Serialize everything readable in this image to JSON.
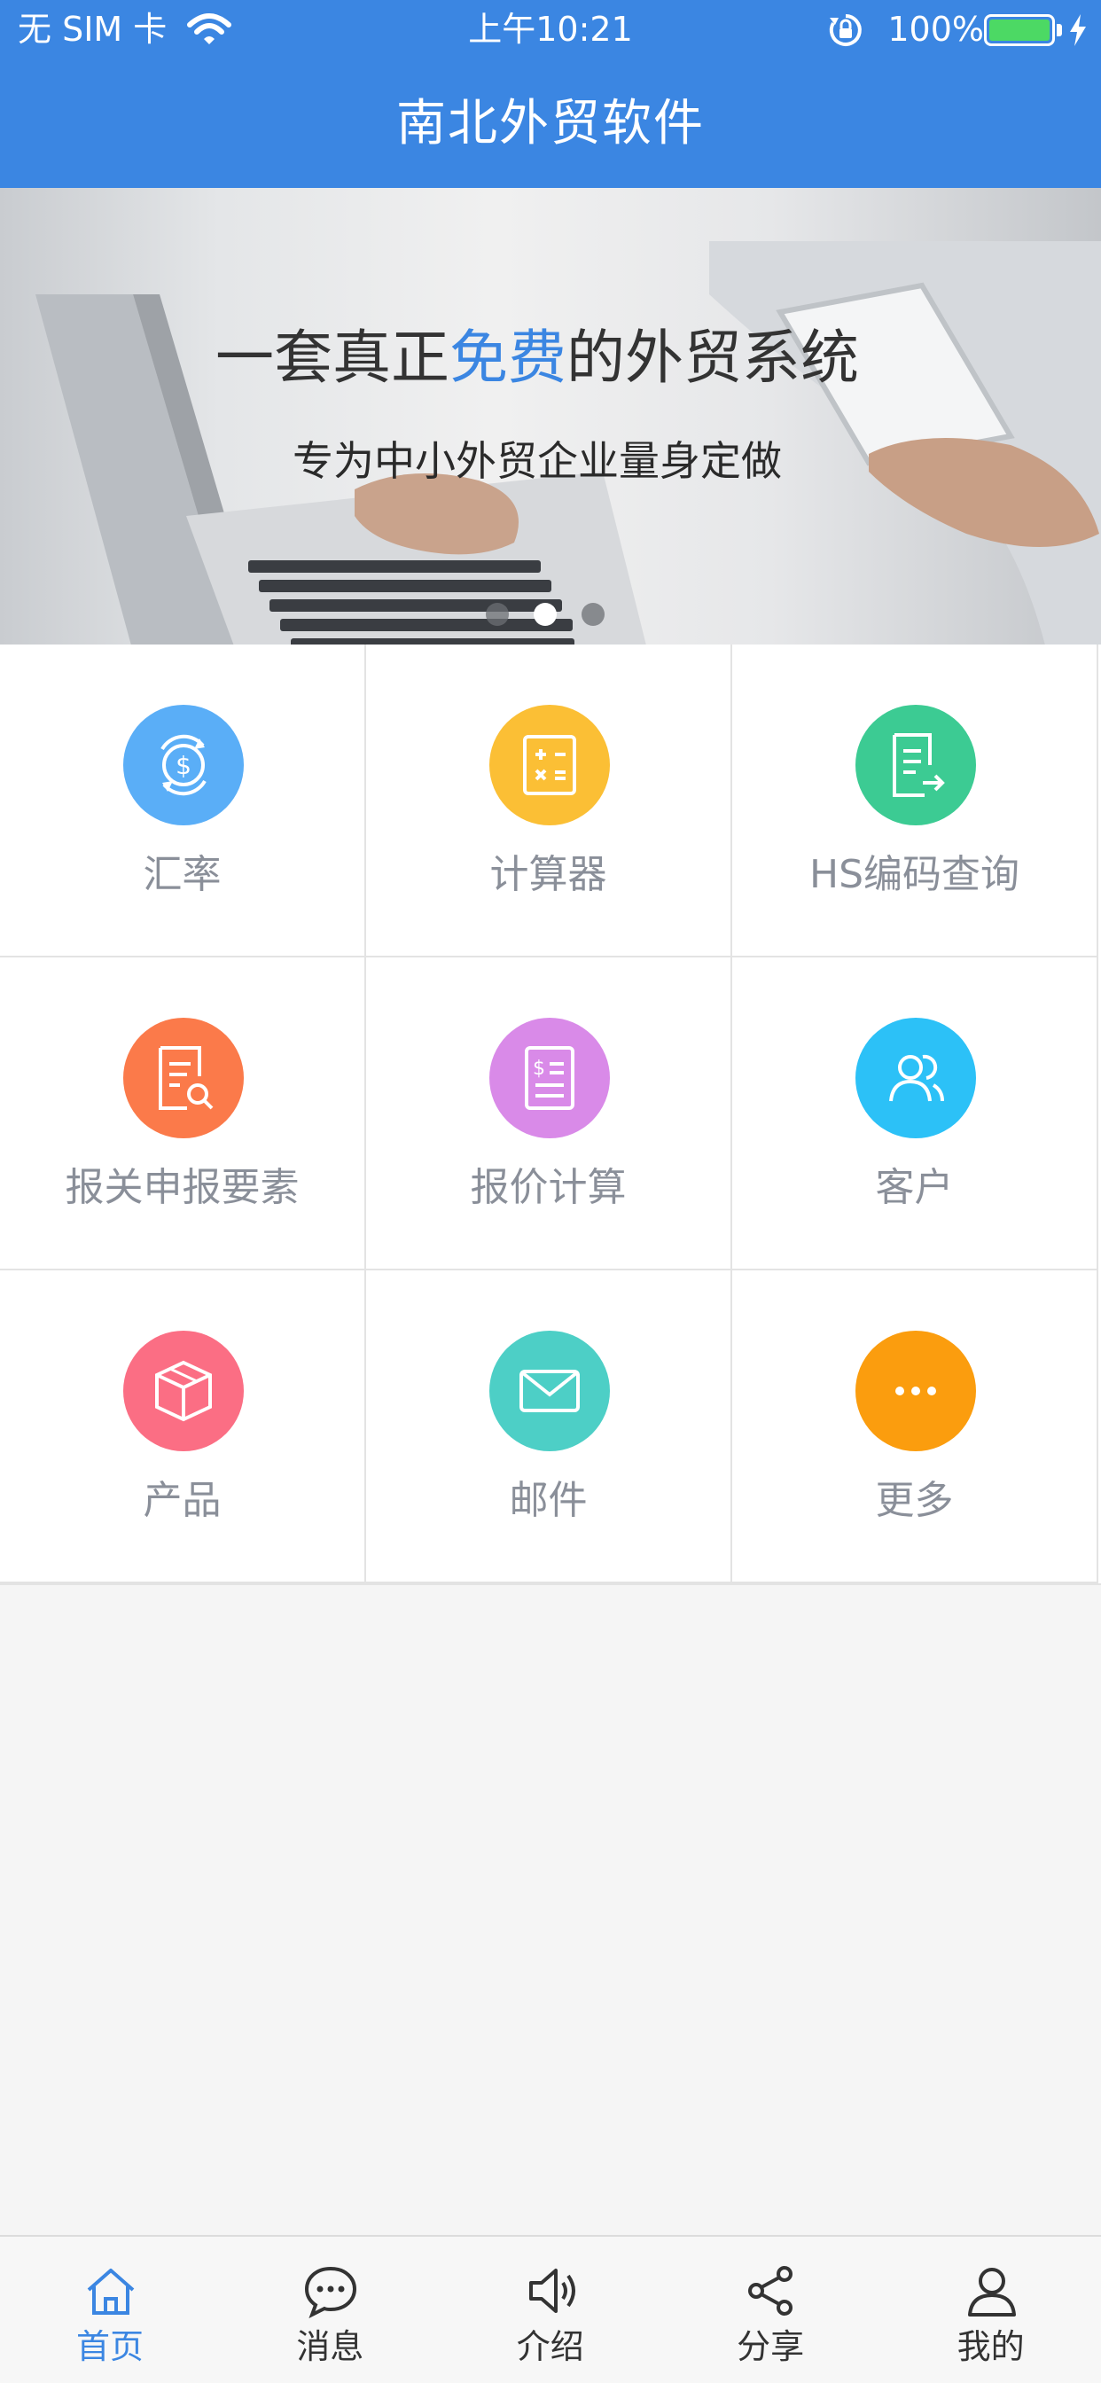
{
  "status_bar": {
    "carrier": "无 SIM 卡",
    "time": "上午10:21",
    "battery_text": "100%",
    "battery_level": 1.0,
    "icons": [
      "wifi-icon",
      "orientation-lock-icon",
      "battery-icon",
      "charging-icon"
    ]
  },
  "nav": {
    "title": "南北外贸软件"
  },
  "banner": {
    "headline_pre": "一套真正",
    "headline_highlight": "免费",
    "headline_post": "的外贸系统",
    "subtitle": "专为中小外贸企业量身定做",
    "slide_count": 3,
    "active_slide": 1
  },
  "grid": {
    "items": [
      {
        "label": "汇率",
        "icon": "currency-exchange-icon",
        "color": "#5aaef7"
      },
      {
        "label": "计算器",
        "icon": "calculator-icon",
        "color": "#fbbf35"
      },
      {
        "label": "HS编码查询",
        "icon": "document-export-icon",
        "color": "#3ccb93"
      },
      {
        "label": "报关申报要素",
        "icon": "document-search-icon",
        "color": "#fb7a4a"
      },
      {
        "label": "报价计算",
        "icon": "price-sheet-icon",
        "color": "#d98ae8"
      },
      {
        "label": "客户",
        "icon": "customers-icon",
        "color": "#2cc1f7"
      },
      {
        "label": "产品",
        "icon": "product-box-icon",
        "color": "#fb6e84"
      },
      {
        "label": "邮件",
        "icon": "mail-icon",
        "color": "#4dcfc6"
      },
      {
        "label": "更多",
        "icon": "more-icon",
        "color": "#fb9d0e"
      }
    ]
  },
  "tabbar": {
    "active_index": 0,
    "accent": "#3b86e2",
    "items": [
      {
        "label": "首页",
        "icon": "home-icon"
      },
      {
        "label": "消息",
        "icon": "message-icon"
      },
      {
        "label": "介绍",
        "icon": "speaker-icon"
      },
      {
        "label": "分享",
        "icon": "share-icon"
      },
      {
        "label": "我的",
        "icon": "profile-icon"
      }
    ]
  }
}
